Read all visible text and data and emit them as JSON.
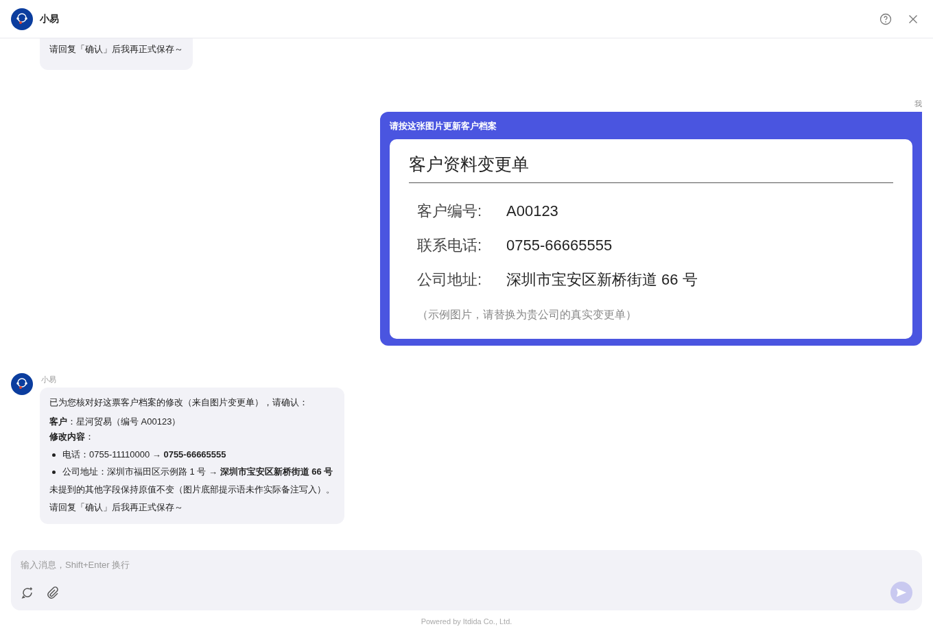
{
  "header": {
    "title": "小易"
  },
  "messages": [
    {
      "kind": "bot",
      "paragraphs": [
        "请回复「确认」后我再正式保存～"
      ]
    },
    {
      "kind": "user",
      "sender": "我",
      "text": "请按这张图片更新客户档案",
      "document": {
        "title": "客户资料变更单",
        "fields": [
          {
            "label": "客户编号:",
            "value": "A00123"
          },
          {
            "label": "联系电话:",
            "value": "0755-66665555"
          },
          {
            "label": "公司地址:",
            "value": "深圳市宝安区新桥街道 66 号"
          }
        ],
        "note": "（示例图片，请替换为贵公司的真实变更单）"
      }
    },
    {
      "kind": "bot",
      "sender": "小易",
      "paragraphs": [
        "已为您核对好这票客户档案的修改（来自图片变更单），请确认：",
        "**客户**：星河贸易（编号 A00123）",
        "**修改内容**："
      ],
      "bullets": [
        "电话：0755-11110000 → **0755-66665555**",
        "公司地址：深圳市福田区示例路 1 号 → **深圳市宝安区新桥街道 66 号**"
      ],
      "after": [
        "未提到的其他字段保持原值不变（图片底部提示语未作实际备注写入）。",
        "请回复「确认」后我再正式保存～"
      ]
    }
  ],
  "composer": {
    "placeholder": "输入消息，Shift+Enter 换行"
  },
  "footer": "Powered by Itdida Co., Ltd."
}
